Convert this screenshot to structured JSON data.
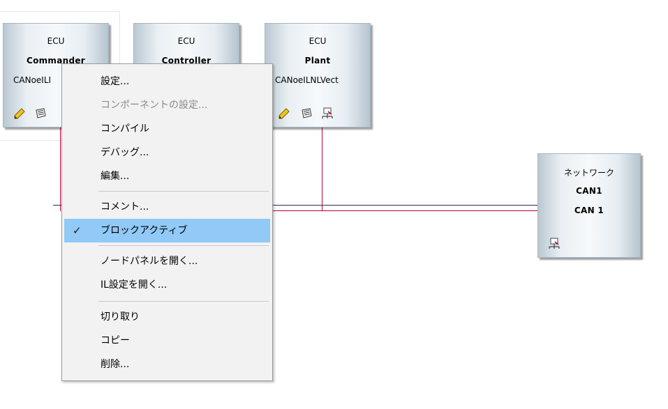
{
  "nodes": [
    {
      "type": "ECU",
      "name": "Commander",
      "detail": "CANoeILI"
    },
    {
      "type": "ECU",
      "name": "Controller",
      "detail": ""
    },
    {
      "type": "ECU",
      "name": "Plant",
      "detail": "CANoeILNLVect"
    }
  ],
  "network": {
    "type": "ネットワーク",
    "name": "CAN1",
    "detail": "CAN 1"
  },
  "context_menu": {
    "items": [
      {
        "label": "設定...",
        "enabled": true
      },
      {
        "label": "コンポーネントの設定...",
        "enabled": false
      },
      {
        "label": "コンパイル",
        "enabled": true
      },
      {
        "label": "デバッグ...",
        "enabled": true
      },
      {
        "label": "編集...",
        "enabled": true
      },
      {
        "label": "コメント...",
        "enabled": true
      },
      {
        "label": "ブロックアクティブ",
        "enabled": true,
        "checked": true,
        "highlighted": true
      },
      {
        "label": "ノードパネルを開く...",
        "enabled": true
      },
      {
        "label": "IL設定を開く...",
        "enabled": true
      },
      {
        "label": "切り取り",
        "enabled": true
      },
      {
        "label": "コピー",
        "enabled": true
      },
      {
        "label": "削除...",
        "enabled": true
      }
    ],
    "check_mark": "✓"
  },
  "colors": {
    "bus_dark": "#2a2a5a",
    "bus_red": "#b5003a",
    "highlight": "#91c9f7"
  },
  "icons": [
    "pencil-icon",
    "database-icon",
    "network-node-icon"
  ]
}
